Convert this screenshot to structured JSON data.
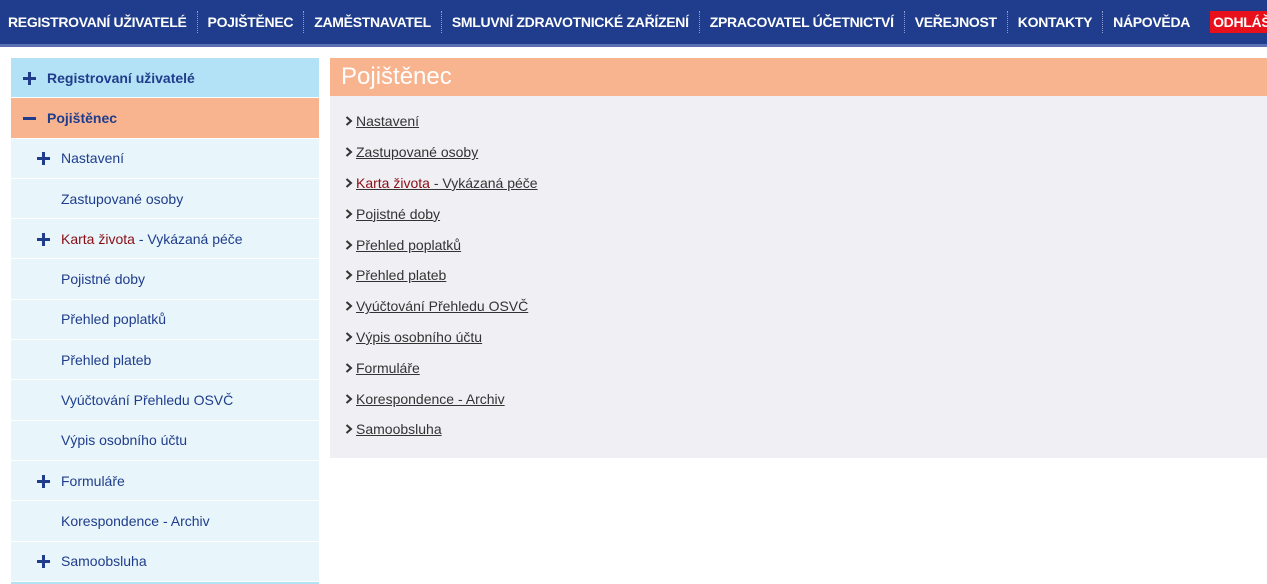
{
  "topnav": {
    "items": [
      "REGISTROVANÍ UŽIVATELÉ",
      "POJIŠTĚNEC",
      "ZAMĚSTNAVATEL",
      "SMLUVNÍ ZDRAVOTNICKÉ ZAŘÍZENÍ",
      "ZPRACOVATEL ÚČETNICTVÍ",
      "VEŘEJNOST",
      "KONTAKTY",
      "NÁPOVĚDA"
    ],
    "logout": "ODHLÁŠENÍ"
  },
  "sidebar": {
    "registered": "Registrovaní uživatelé",
    "insured": "Pojištěnec",
    "items": [
      {
        "label": "Nastavení",
        "expand": "plus"
      },
      {
        "label": "Zastupované osoby",
        "expand": ""
      },
      {
        "label_red": "Karta života",
        "label_rest": " - Vykázaná péče",
        "expand": "plus"
      },
      {
        "label": "Pojistné doby",
        "expand": ""
      },
      {
        "label": "Přehled poplatků",
        "expand": ""
      },
      {
        "label": "Přehled plateb",
        "expand": ""
      },
      {
        "label": "Vyúčtování Přehledu OSVČ",
        "expand": ""
      },
      {
        "label": "Výpis osobního účtu",
        "expand": ""
      },
      {
        "label": "Formuláře",
        "expand": "plus"
      },
      {
        "label": "Korespondence - Archiv",
        "expand": ""
      },
      {
        "label": "Samoobsluha",
        "expand": "plus"
      }
    ]
  },
  "main": {
    "title": "Pojištěnec",
    "links": [
      {
        "label": "Nastavení"
      },
      {
        "label": "Zastupované osoby"
      },
      {
        "label_red": "Karta života",
        "label_rest": " - Vykázaná péče"
      },
      {
        "label": "Pojistné doby"
      },
      {
        "label": "Přehled poplatků"
      },
      {
        "label": "Přehled plateb"
      },
      {
        "label": "Vyúčtování Přehledu OSVČ"
      },
      {
        "label": "Výpis osobního účtu"
      },
      {
        "label": "Formuláře"
      },
      {
        "label": "Korespondence - Archiv"
      },
      {
        "label": "Samoobsluha"
      }
    ]
  },
  "colors": {
    "nav_bg": "#1f3d8c",
    "logout_bg": "#e8101a",
    "accent_orange": "#f8b48f",
    "accent_blue": "#b3e1f5",
    "sub_blue": "#e8f5fb",
    "dark_red": "#8a0e14"
  },
  "icons": {
    "expand": "plus-icon",
    "collapse": "minus-icon",
    "link_bullet": "chevron-right-icon"
  }
}
